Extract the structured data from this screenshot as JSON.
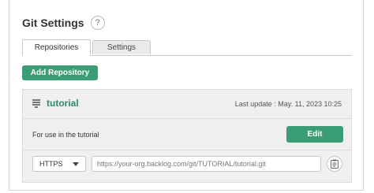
{
  "header": {
    "title": "Git Settings",
    "help_icon": "?"
  },
  "tabs": [
    {
      "label": "Repositories",
      "active": true
    },
    {
      "label": "Settings",
      "active": false
    }
  ],
  "toolbar": {
    "add_label": "Add Repository"
  },
  "repository": {
    "icon": "server-icon",
    "name": "tutorial",
    "last_update": "Last update : May. 11, 2023 10:25",
    "description": "For use in the tutorial",
    "edit_label": "Edit",
    "protocol": "HTTPS",
    "url": "https://your-org.backlog.com/git/TUTORIAL/tutorial.git",
    "copy_icon": "clipboard-icon"
  },
  "colors": {
    "accent": "#3a9d76",
    "link": "#2f8a68"
  }
}
